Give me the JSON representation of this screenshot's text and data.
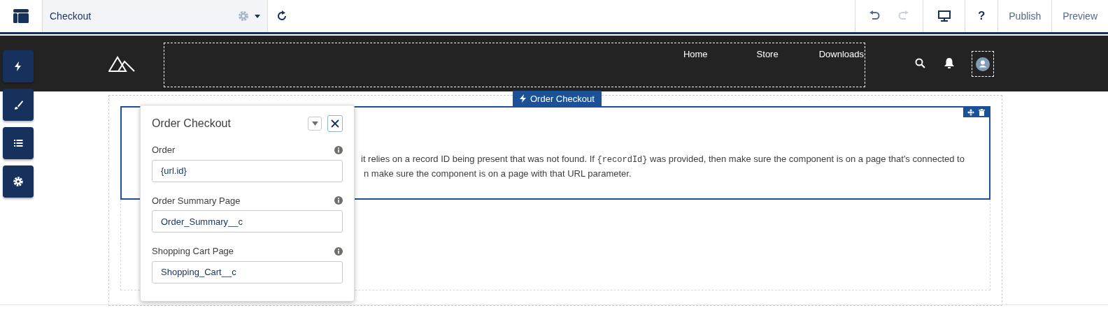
{
  "toolbar": {
    "page_name": "Checkout",
    "undo_disabled": false,
    "redo_disabled": true,
    "buttons": [
      "Publish",
      "Preview"
    ],
    "help": "?"
  },
  "site_header": {
    "nav_items": [
      {
        "label": "Home"
      },
      {
        "label": "Store"
      },
      {
        "label": "Downloads"
      }
    ]
  },
  "side_buttons": [
    {
      "kind": "lightning"
    },
    {
      "kind": "brush"
    },
    {
      "kind": "list"
    },
    {
      "kind": "gear"
    }
  ],
  "component": {
    "tag": "Order Checkout",
    "message_lines": [
      "it relies on a record ID being present that was not found. If {recordId} was provided, then make sure the component is on a page that's connected to",
      "n make sure the component is on a page with that URL parameter."
    ]
  },
  "property_panel": {
    "title": "Order Checkout",
    "fields": [
      {
        "label": "Order",
        "value": "{url.id}"
      },
      {
        "label": "Order Summary Page",
        "value": "Order_Summary__c"
      },
      {
        "label": "Shopping Cart Page",
        "value": "Shopping_Cart__c"
      }
    ]
  }
}
